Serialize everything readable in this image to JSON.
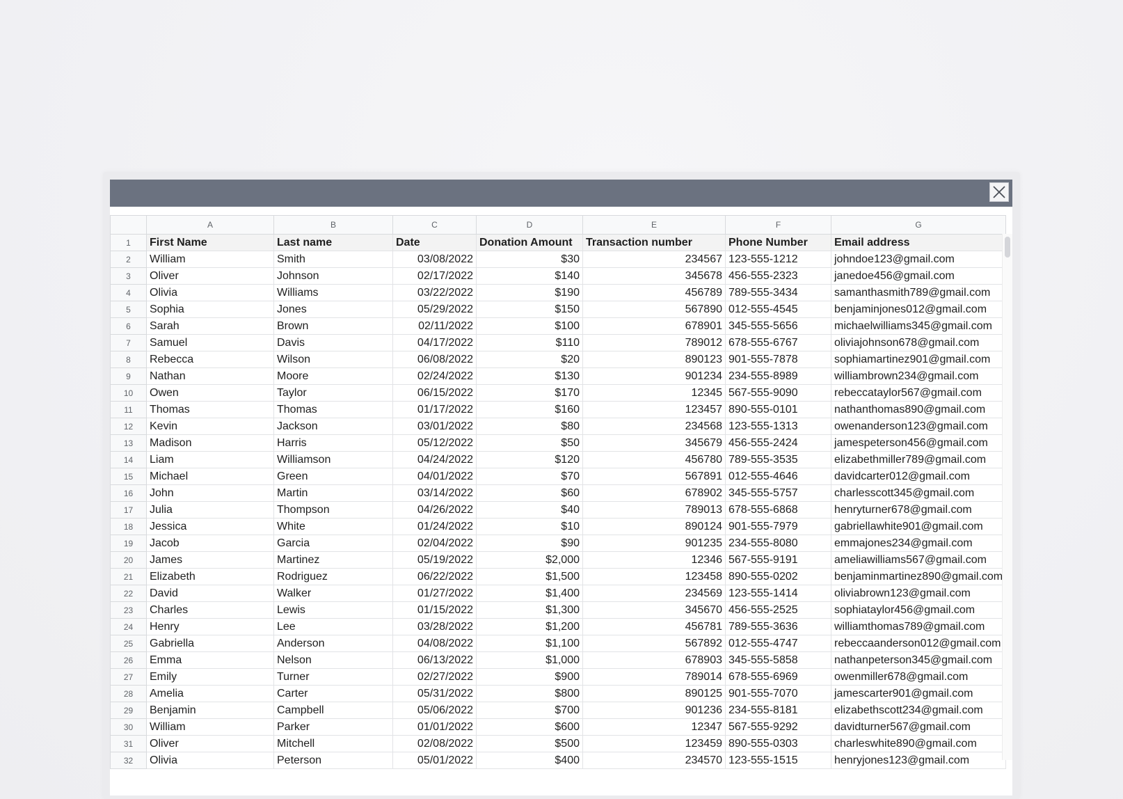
{
  "dialog": {
    "close_icon": "close-icon"
  },
  "sheet": {
    "column_letters": [
      "A",
      "B",
      "C",
      "D",
      "E",
      "F",
      "G"
    ],
    "headers": [
      "First Name",
      "Last name",
      "Date",
      "Donation Amount",
      "Transaction number",
      "Phone Number",
      "Email address"
    ],
    "rows": [
      {
        "n": "2",
        "first": "William",
        "last": "Smith",
        "date": "03/08/2022",
        "amount": "$30",
        "txn": "234567",
        "phone": "123-555-1212",
        "email": "johndoe123@gmail.com"
      },
      {
        "n": "3",
        "first": "Oliver",
        "last": "Johnson",
        "date": "02/17/2022",
        "amount": "$140",
        "txn": "345678",
        "phone": "456-555-2323",
        "email": "janedoe456@gmail.com"
      },
      {
        "n": "4",
        "first": "Olivia",
        "last": "Williams",
        "date": "03/22/2022",
        "amount": "$190",
        "txn": "456789",
        "phone": "789-555-3434",
        "email": "samanthasmith789@gmail.com"
      },
      {
        "n": "5",
        "first": "Sophia",
        "last": "Jones",
        "date": "05/29/2022",
        "amount": "$150",
        "txn": "567890",
        "phone": "012-555-4545",
        "email": "benjaminjones012@gmail.com"
      },
      {
        "n": "6",
        "first": "Sarah",
        "last": "Brown",
        "date": "02/11/2022",
        "amount": "$100",
        "txn": "678901",
        "phone": "345-555-5656",
        "email": "michaelwilliams345@gmail.com"
      },
      {
        "n": "7",
        "first": "Samuel",
        "last": "Davis",
        "date": "04/17/2022",
        "amount": "$110",
        "txn": "789012",
        "phone": "678-555-6767",
        "email": "oliviajohnson678@gmail.com"
      },
      {
        "n": "8",
        "first": "Rebecca",
        "last": "Wilson",
        "date": "06/08/2022",
        "amount": "$20",
        "txn": "890123",
        "phone": "901-555-7878",
        "email": "sophiamartinez901@gmail.com"
      },
      {
        "n": "9",
        "first": "Nathan",
        "last": "Moore",
        "date": "02/24/2022",
        "amount": "$130",
        "txn": "901234",
        "phone": "234-555-8989",
        "email": "williambrown234@gmail.com"
      },
      {
        "n": "10",
        "first": "Owen",
        "last": "Taylor",
        "date": "06/15/2022",
        "amount": "$170",
        "txn": "12345",
        "phone": "567-555-9090",
        "email": "rebeccataylor567@gmail.com"
      },
      {
        "n": "11",
        "first": "Thomas",
        "last": "Thomas",
        "date": "01/17/2022",
        "amount": "$160",
        "txn": "123457",
        "phone": "890-555-0101",
        "email": "nathanthomas890@gmail.com"
      },
      {
        "n": "12",
        "first": "Kevin",
        "last": "Jackson",
        "date": "03/01/2022",
        "amount": "$80",
        "txn": "234568",
        "phone": "123-555-1313",
        "email": "owenanderson123@gmail.com"
      },
      {
        "n": "13",
        "first": "Madison",
        "last": "Harris",
        "date": "05/12/2022",
        "amount": "$50",
        "txn": "345679",
        "phone": "456-555-2424",
        "email": "jamespeterson456@gmail.com"
      },
      {
        "n": "14",
        "first": "Liam",
        "last": "Williamson",
        "date": "04/24/2022",
        "amount": "$120",
        "txn": "456780",
        "phone": "789-555-3535",
        "email": "elizabethmiller789@gmail.com"
      },
      {
        "n": "15",
        "first": "Michael",
        "last": "Green",
        "date": "04/01/2022",
        "amount": "$70",
        "txn": "567891",
        "phone": "012-555-4646",
        "email": "davidcarter012@gmail.com"
      },
      {
        "n": "16",
        "first": "John",
        "last": "Martin",
        "date": "03/14/2022",
        "amount": "$60",
        "txn": "678902",
        "phone": "345-555-5757",
        "email": "charlesscott345@gmail.com"
      },
      {
        "n": "17",
        "first": "Julia",
        "last": "Thompson",
        "date": "04/26/2022",
        "amount": "$40",
        "txn": "789013",
        "phone": "678-555-6868",
        "email": "henryturner678@gmail.com"
      },
      {
        "n": "18",
        "first": "Jessica",
        "last": "White",
        "date": "01/24/2022",
        "amount": "$10",
        "txn": "890124",
        "phone": "901-555-7979",
        "email": "gabriellawhite901@gmail.com"
      },
      {
        "n": "19",
        "first": "Jacob",
        "last": "Garcia",
        "date": "02/04/2022",
        "amount": "$90",
        "txn": "901235",
        "phone": "234-555-8080",
        "email": "emmajones234@gmail.com"
      },
      {
        "n": "20",
        "first": "James",
        "last": "Martinez",
        "date": "05/19/2022",
        "amount": "$2,000",
        "txn": "12346",
        "phone": "567-555-9191",
        "email": "ameliawilliams567@gmail.com"
      },
      {
        "n": "21",
        "first": "Elizabeth",
        "last": "Rodriguez",
        "date": "06/22/2022",
        "amount": "$1,500",
        "txn": "123458",
        "phone": "890-555-0202",
        "email": "benjaminmartinez890@gmail.com"
      },
      {
        "n": "22",
        "first": "David",
        "last": "Walker",
        "date": "01/27/2022",
        "amount": "$1,400",
        "txn": "234569",
        "phone": "123-555-1414",
        "email": "oliviabrown123@gmail.com"
      },
      {
        "n": "23",
        "first": "Charles",
        "last": "Lewis",
        "date": "01/15/2022",
        "amount": "$1,300",
        "txn": "345670",
        "phone": "456-555-2525",
        "email": "sophiataylor456@gmail.com"
      },
      {
        "n": "24",
        "first": "Henry",
        "last": "Lee",
        "date": "03/28/2022",
        "amount": "$1,200",
        "txn": "456781",
        "phone": "789-555-3636",
        "email": "williamthomas789@gmail.com"
      },
      {
        "n": "25",
        "first": "Gabriella",
        "last": "Anderson",
        "date": "04/08/2022",
        "amount": "$1,100",
        "txn": "567892",
        "phone": "012-555-4747",
        "email": "rebeccaanderson012@gmail.com"
      },
      {
        "n": "26",
        "first": "Emma",
        "last": "Nelson",
        "date": "06/13/2022",
        "amount": "$1,000",
        "txn": "678903",
        "phone": "345-555-5858",
        "email": "nathanpeterson345@gmail.com"
      },
      {
        "n": "27",
        "first": "Emily",
        "last": "Turner",
        "date": "02/27/2022",
        "amount": "$900",
        "txn": "789014",
        "phone": "678-555-6969",
        "email": "owenmiller678@gmail.com"
      },
      {
        "n": "28",
        "first": "Amelia",
        "last": "Carter",
        "date": "05/31/2022",
        "amount": "$800",
        "txn": "890125",
        "phone": "901-555-7070",
        "email": "jamescarter901@gmail.com"
      },
      {
        "n": "29",
        "first": "Benjamin",
        "last": "Campbell",
        "date": "05/06/2022",
        "amount": "$700",
        "txn": "901236",
        "phone": "234-555-8181",
        "email": "elizabethscott234@gmail.com"
      },
      {
        "n": "30",
        "first": "William",
        "last": "Parker",
        "date": "01/01/2022",
        "amount": "$600",
        "txn": "12347",
        "phone": "567-555-9292",
        "email": "davidturner567@gmail.com"
      },
      {
        "n": "31",
        "first": "Oliver",
        "last": "Mitchell",
        "date": "02/08/2022",
        "amount": "$500",
        "txn": "123459",
        "phone": "890-555-0303",
        "email": "charleswhite890@gmail.com"
      },
      {
        "n": "32",
        "first": "Olivia",
        "last": "Peterson",
        "date": "05/01/2022",
        "amount": "$400",
        "txn": "234570",
        "phone": "123-555-1515",
        "email": "henryjones123@gmail.com"
      }
    ]
  }
}
